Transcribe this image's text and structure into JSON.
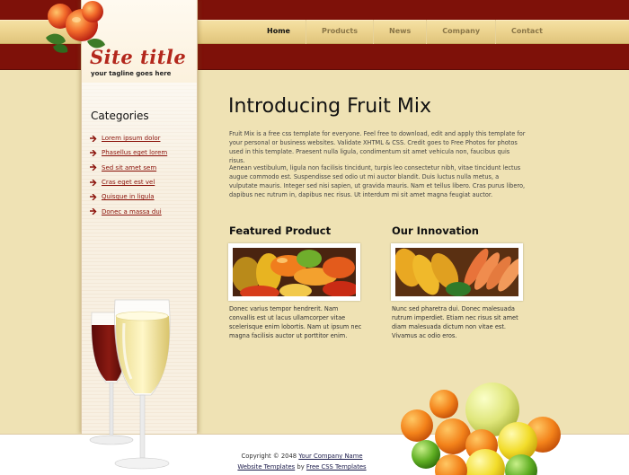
{
  "header": {
    "site_title": "Site title",
    "tagline": "your tagline goes here"
  },
  "nav": {
    "items": [
      {
        "label": "Home",
        "active": true
      },
      {
        "label": "Products"
      },
      {
        "label": "News"
      },
      {
        "label": "Company"
      },
      {
        "label": "Contact"
      }
    ]
  },
  "sidebar": {
    "heading": "Categories",
    "items": [
      {
        "label": "Lorem ipsum dolor"
      },
      {
        "label": "Phasellus eget lorem"
      },
      {
        "label": "Sed sit amet sem"
      },
      {
        "label": "Cras eget est vel"
      },
      {
        "label": "Quisque in ligula"
      },
      {
        "label": "Donec a massa dui"
      }
    ]
  },
  "main": {
    "title": "Introducing Fruit Mix",
    "paragraph1": "Fruit Mix is a free css template for everyone. Feel free to download, edit and apply this template for your personal or business websites. Validate XHTML & CSS. Credit goes to Free Photos for photos used in this template. Praesent nulla ligula, condimentum sit amet vehicula non, faucibus quis risus.",
    "paragraph2": "Aenean vestibulum, ligula non facilisis tincidunt, turpis leo consectetur nibh, vitae tincidunt lectus augue commodo est. Suspendisse sed odio ut mi auctor blandit. Duis luctus nulla metus, a vulputate mauris. Integer sed nisi sapien, ut gravida mauris. Nam et tellus libero. Cras purus libero, dapibus nec rutrum in, dapibus nec risus. Ut interdum mi sit amet magna feugiat auctor.",
    "featured": {
      "heading": "Featured Product",
      "text": "Donec varius tempor hendrerit. Nam convallis est ut lacus ullamcorper vitae scelerisque enim lobortis. Nam ut ipsum nec magna facilisis auctor ut porttitor enim."
    },
    "innovation": {
      "heading": "Our Innovation",
      "text": "Nunc sed pharetra dui. Donec malesuada rutrum imperdiet. Etiam nec risus sit amet diam malesuada dictum non vitae est. Vivamus ac odio eros."
    }
  },
  "footer": {
    "copyright_prefix": "Copyright © 2048",
    "company_link": "Your Company Name",
    "templates_link": "Website Templates",
    "by_text": "by",
    "css_link": "Free CSS Templates"
  },
  "icons": {
    "logo": "peaches-icon",
    "sidebar_bottom": "wine-glasses-icon",
    "footer_right": "citrus-fruit-icon",
    "list_marker": "arrow-bullet-icon"
  },
  "colors": {
    "brand_red": "#7e1109",
    "title_red": "#b3271c",
    "background": "#efe2b4",
    "nav_gold": "#ecd38e",
    "link": "#8a1109"
  }
}
